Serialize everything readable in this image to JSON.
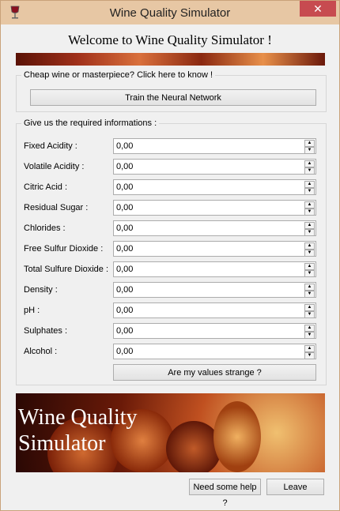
{
  "window": {
    "title": "Wine Quality Simulator",
    "close_glyph": "✕",
    "min_glyph": "—",
    "max_glyph": "▢"
  },
  "header": {
    "welcome": "Welcome to Wine Quality Simulator !"
  },
  "train_group": {
    "label": "Cheap wine or masterpiece? Click here to know !",
    "button": "Train the Neural Network"
  },
  "inputs_group": {
    "label": "Give us the required informations :",
    "fields": [
      {
        "label": "Fixed Acidity :",
        "value": "0,00"
      },
      {
        "label": "Volatile Acidity :",
        "value": "0,00"
      },
      {
        "label": "Citric Acid :",
        "value": "0,00"
      },
      {
        "label": "Residual Sugar :",
        "value": "0,00"
      },
      {
        "label": "Chlorides :",
        "value": "0,00"
      },
      {
        "label": "Free Sulfur Dioxide :",
        "value": "0,00"
      },
      {
        "label": "Total Sulfure Dioxide :",
        "value": "0,00"
      },
      {
        "label": "Density :",
        "value": "0,00"
      },
      {
        "label": "pH :",
        "value": "0,00"
      },
      {
        "label": "Sulphates :",
        "value": "0,00"
      },
      {
        "label": "Alcohol :",
        "value": "0,00"
      }
    ],
    "check_button": "Are my values strange ?"
  },
  "banner": {
    "line1": "Wine Quality",
    "line2": "Simulator"
  },
  "footer": {
    "help_button": "Need some help ?",
    "leave_button": "Leave"
  }
}
